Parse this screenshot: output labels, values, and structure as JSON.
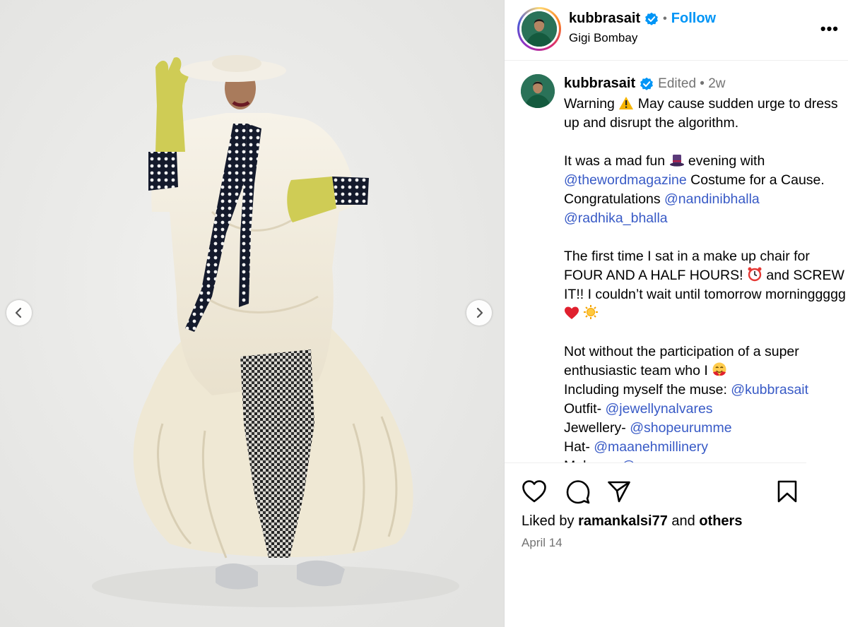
{
  "header": {
    "username": "kubbrasait",
    "separator": "•",
    "follow_label": "Follow",
    "location": "Gigi Bombay",
    "more_label": "•••"
  },
  "caption": {
    "username": "kubbrasait",
    "meta": "Edited • 2w",
    "lines": [
      {
        "parts": [
          {
            "t": "Warning "
          },
          {
            "e": "warning"
          },
          {
            "t": " May cause sudden urge to dress up and disrupt the algorithm."
          }
        ]
      },
      {
        "parts": []
      },
      {
        "parts": [
          {
            "t": "It was a mad fun "
          },
          {
            "e": "tophat"
          },
          {
            "t": " evening with "
          },
          {
            "m": "@thewordmagazine"
          },
          {
            "t": " Costume for a Cause. Congratulations "
          },
          {
            "m": "@nandinibhalla"
          },
          {
            "t": " "
          },
          {
            "m": "@radhika_bhalla"
          }
        ]
      },
      {
        "parts": []
      },
      {
        "parts": [
          {
            "t": "The first time I sat in a make up chair for FOUR AND A HALF HOURS! "
          },
          {
            "e": "alarm"
          },
          {
            "t": " and SCREW IT!! I couldn’t wait until tomorrow morninggggg "
          },
          {
            "e": "heart"
          },
          {
            "t": " "
          },
          {
            "e": "sun"
          }
        ]
      },
      {
        "parts": []
      },
      {
        "parts": [
          {
            "t": "Not without the participation of a super enthusiastic team who I "
          },
          {
            "e": "hugface"
          }
        ]
      },
      {
        "parts": [
          {
            "t": "Including myself the muse: "
          },
          {
            "m": "@kubbrasait"
          }
        ]
      },
      {
        "parts": [
          {
            "t": "Outfit- "
          },
          {
            "m": "@jewellynalvares"
          }
        ]
      },
      {
        "parts": [
          {
            "t": "Jewellery- "
          },
          {
            "m": "@shopeurumme"
          }
        ]
      },
      {
        "parts": [
          {
            "t": "Hat- "
          },
          {
            "m": "@maanehmillinery"
          }
        ]
      },
      {
        "parts": [
          {
            "t": "Makeup- "
          },
          {
            "m": "@..."
          }
        ]
      }
    ]
  },
  "actions": {
    "like_icon": "heart-outline-icon",
    "comment_icon": "comment-bubble-icon",
    "share_icon": "paper-plane-icon",
    "save_icon": "bookmark-icon"
  },
  "likes": {
    "prefix": "Liked by ",
    "user": "ramankalsi77",
    "middle": " and ",
    "others": "others"
  },
  "date": "April 14",
  "carousel": {
    "total": 8,
    "active_index": 6,
    "prev_icon": "chevron-left-icon",
    "next_icon": "chevron-right-icon"
  },
  "colors": {
    "follow": "#0095f6",
    "mention": "#385ac6",
    "verified": "#0095f6",
    "muted": "#737373"
  }
}
